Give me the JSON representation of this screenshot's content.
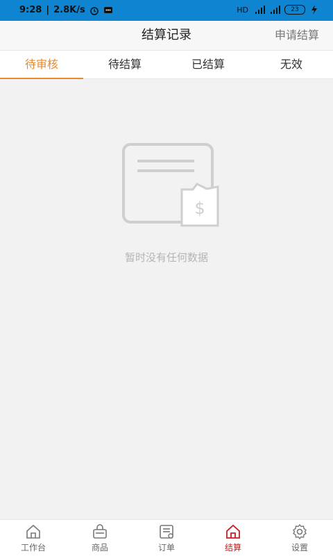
{
  "status_bar": {
    "time": "9:28",
    "speed": "2.8K/s",
    "battery": "23",
    "hd_label": "HD"
  },
  "header": {
    "title": "结算记录",
    "action_label": "申请结算"
  },
  "tabs": [
    {
      "label": "待审核",
      "active": true
    },
    {
      "label": "待结算",
      "active": false
    },
    {
      "label": "已结算",
      "active": false
    },
    {
      "label": "无效",
      "active": false
    }
  ],
  "empty_state": {
    "message": "暂时没有任何数据",
    "icon": "settlement-empty-icon"
  },
  "bottom_nav": [
    {
      "label": "工作台",
      "icon": "home-icon",
      "active": false
    },
    {
      "label": "商品",
      "icon": "basket-icon",
      "active": false
    },
    {
      "label": "订单",
      "icon": "order-icon",
      "active": false
    },
    {
      "label": "结算",
      "icon": "settlement-home-icon",
      "active": true
    },
    {
      "label": "设置",
      "icon": "gear-icon",
      "active": false
    }
  ],
  "colors": {
    "status_bar": "#0f84d0",
    "accent_tab": "#e8892b",
    "accent_nav": "#c81e1e"
  }
}
